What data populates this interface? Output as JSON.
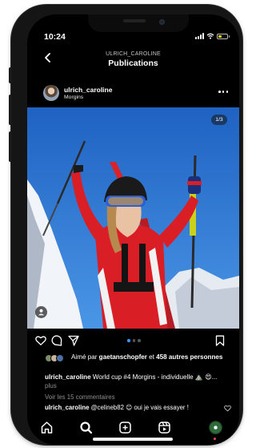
{
  "status_bar": {
    "time": "10:24"
  },
  "header": {
    "username_caption": "ULRICH_CAROLINE",
    "title": "Publications"
  },
  "post": {
    "author": "ulrich_caroline",
    "location": "Morgins",
    "media_counter": "1/3",
    "carousel_total": 3,
    "carousel_active_index": 0
  },
  "likes": {
    "prefix": "Aimé par ",
    "first_user": "gaetanschopfer",
    "joiner": " et ",
    "others": "458 autres personnes"
  },
  "caption": {
    "author": "ulrich_caroline",
    "text": " World cup #4 Morgins - individuelle ⛰️ 😍... ",
    "more": "plus"
  },
  "comments_link": "Voir les 15 commentaires",
  "comment": {
    "author": "ulrich_caroline",
    "text": " @celineb82 😊 oui je vais essayer !"
  },
  "colors": {
    "background": "#000000",
    "text": "#ffffff",
    "secondary_text": "#8e8e8e",
    "accent": "#3897f0",
    "notification": "#ed4956"
  },
  "icons": {
    "back": "chevron-left-icon",
    "more": "ellipsis-icon",
    "like": "heart-icon",
    "comment": "comment-bubble-icon",
    "share": "paper-plane-icon",
    "save": "bookmark-icon",
    "home": "home-icon",
    "search": "search-icon",
    "create": "plus-square-icon",
    "reels": "reels-icon",
    "profile": "profile-avatar"
  }
}
